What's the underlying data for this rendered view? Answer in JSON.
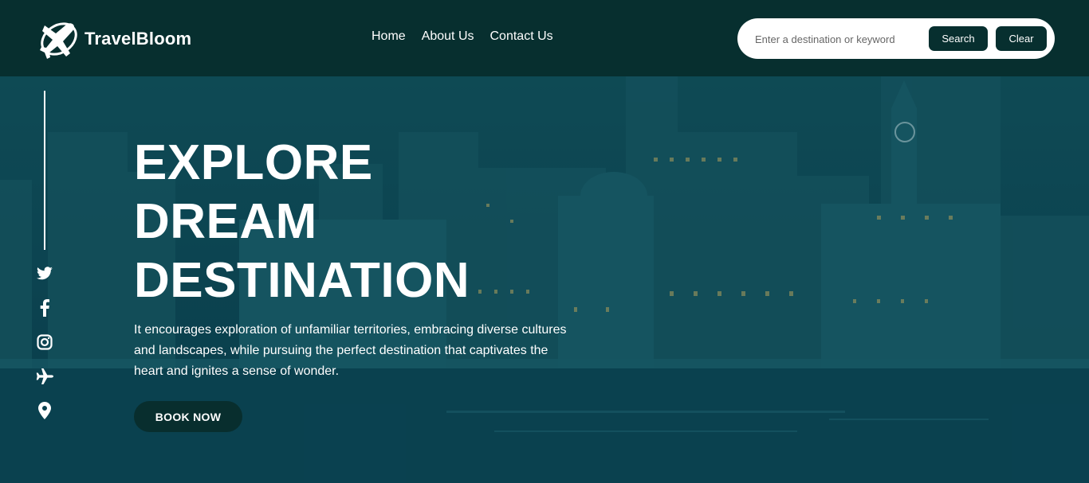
{
  "brand": {
    "name": "TravelBloom",
    "logo_icon": "airplane-icon"
  },
  "nav": {
    "items": [
      {
        "label": "Home"
      },
      {
        "label": "About Us"
      },
      {
        "label": "Contact Us"
      }
    ]
  },
  "search": {
    "placeholder": "Enter a destination or keyword",
    "value": "",
    "search_label": "Search",
    "clear_label": "Clear"
  },
  "hero": {
    "headline": [
      "EXPLORE",
      "DREAM",
      "DESTINATION"
    ],
    "description": "It encourages exploration of unfamiliar territories, embracing diverse cultures and landscapes, while pursuing the perfect destination that captivates the heart and ignites a sense of wonder.",
    "cta_label": "BOOK NOW"
  },
  "social": [
    "twitter-icon",
    "facebook-icon",
    "instagram-icon",
    "airplane-icon",
    "location-pin-icon"
  ],
  "colors": {
    "nav_bg": "#072f2f",
    "hero_tint": "#0f4d5a",
    "button_dark": "#082e2e"
  }
}
